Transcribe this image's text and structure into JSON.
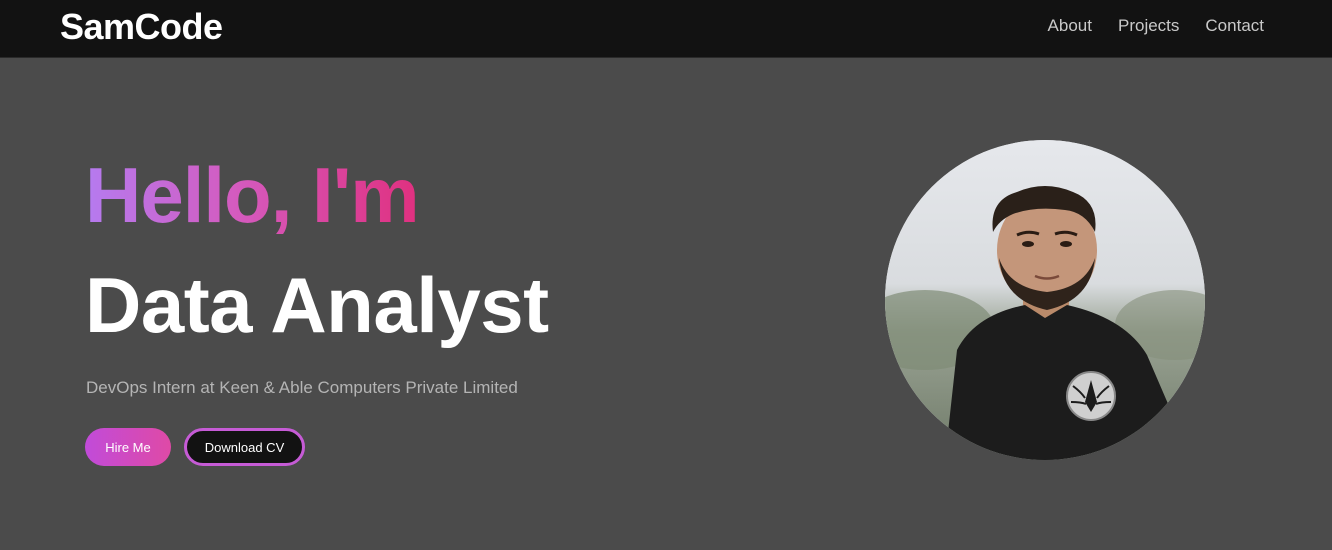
{
  "header": {
    "logo": "SamCode",
    "nav": [
      {
        "label": "About"
      },
      {
        "label": "Projects"
      },
      {
        "label": "Contact"
      }
    ]
  },
  "hero": {
    "greeting": "Hello, I'm",
    "role": "Data Analyst",
    "subtitle": "DevOps Intern at Keen & Able Computers Private Limited",
    "hire_label": "Hire Me",
    "cv_label": "Download CV",
    "avatar_icon": "profile-photo"
  },
  "colors": {
    "nav_bg": "#121212",
    "hero_bg": "#4b4b4b",
    "gradient_start": "#b57bf0",
    "gradient_end": "#e0307f",
    "button_border": "#c65bd6"
  }
}
